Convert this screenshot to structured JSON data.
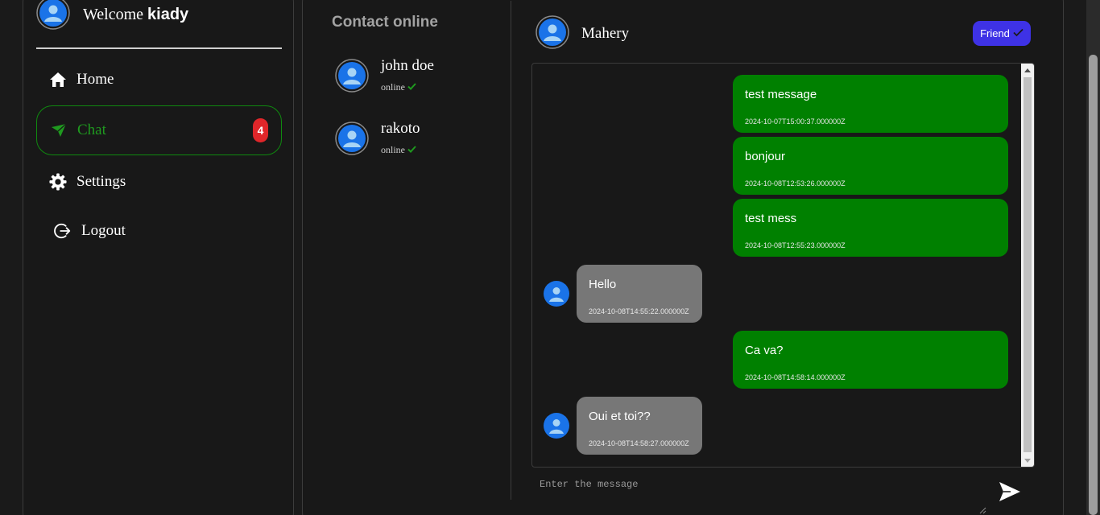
{
  "sidebar": {
    "welcome_label": "Welcome",
    "username": "kiady",
    "nav": [
      {
        "label": "Home",
        "icon": "home-icon"
      },
      {
        "label": "Chat",
        "icon": "send-icon",
        "badge": "4",
        "active": true
      },
      {
        "label": "Settings",
        "icon": "gear-icon"
      },
      {
        "label": "Logout",
        "icon": "logout-icon"
      }
    ]
  },
  "contacts": {
    "title": "Contact online",
    "items": [
      {
        "name": "john doe",
        "status": "online"
      },
      {
        "name": "rakoto",
        "status": "online"
      }
    ]
  },
  "chat": {
    "contact_name": "Mahery",
    "friend_label": "Friend",
    "messages": [
      {
        "direction": "out",
        "text": "test message",
        "time": "2024-10-07T15:00:37.000000Z"
      },
      {
        "direction": "out",
        "text": "bonjour",
        "time": "2024-10-08T12:53:26.000000Z"
      },
      {
        "direction": "out",
        "text": "test mess",
        "time": "2024-10-08T12:55:23.000000Z"
      },
      {
        "direction": "in",
        "text": "Hello",
        "time": "2024-10-08T14:55:22.000000Z"
      },
      {
        "direction": "out",
        "text": "Ca va?",
        "time": "2024-10-08T14:58:14.000000Z"
      },
      {
        "direction": "in",
        "text": "Oui et toi??",
        "time": "2024-10-08T14:58:27.000000Z"
      }
    ],
    "input_placeholder": "Enter the message"
  },
  "colors": {
    "accent_green": "#008000",
    "active_nav_green": "#1f9a1f",
    "friend_button": "#3e32e6",
    "badge_red": "#e0262a",
    "incoming_bubble": "#777777",
    "avatar_blue": "#1a73e8"
  }
}
